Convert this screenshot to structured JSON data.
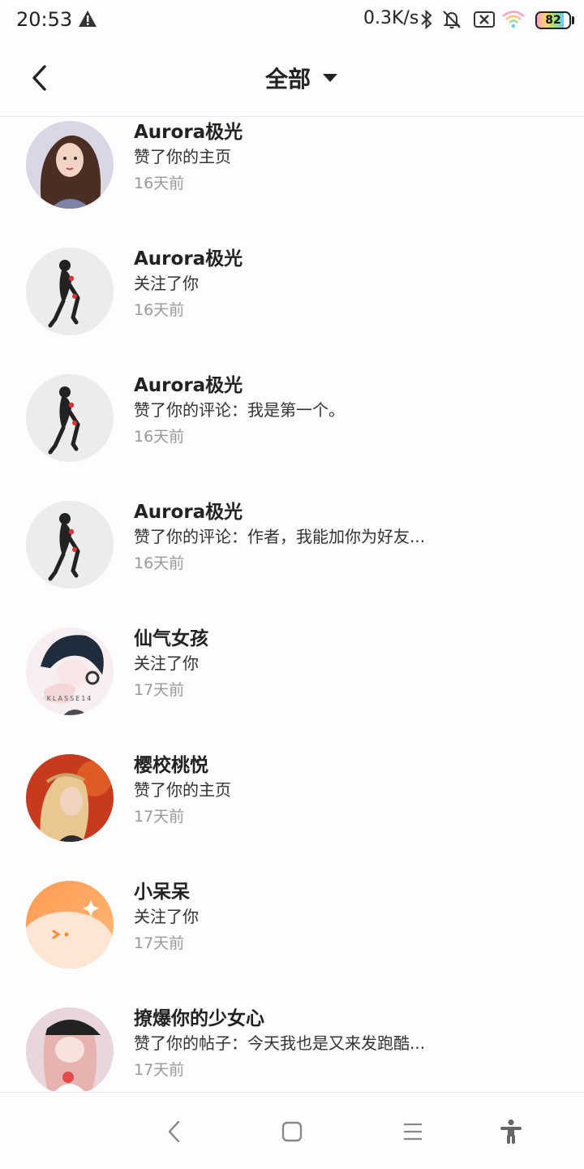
{
  "status_bar": {
    "time": "20:53",
    "net_speed": "0.3K/s",
    "battery": "82",
    "battery_level": 0.82,
    "icons": [
      "warning-icon",
      "bluetooth-icon",
      "bell-muted-icon",
      "sim-off-icon",
      "wifi-icon",
      "battery-icon"
    ]
  },
  "header": {
    "title": "全部",
    "back_icon": "chevron-left-icon",
    "dropdown_icon": "caret-down-icon"
  },
  "notifications": [
    {
      "name": "Aurora极光",
      "action": "赞了你的主页",
      "time": "16天前",
      "avatar": "avatar-curly-girl"
    },
    {
      "name": "Aurora极光",
      "action": "关注了你",
      "time": "16天前",
      "avatar": "avatar-anime-figure"
    },
    {
      "name": "Aurora极光",
      "action": "赞了你的评论：我是第一个。",
      "time": "16天前",
      "avatar": "avatar-anime-figure"
    },
    {
      "name": "Aurora极光",
      "action": "赞了你的评论：作者，我能加你为好友...",
      "time": "16天前",
      "avatar": "avatar-anime-figure"
    },
    {
      "name": "仙气女孩",
      "action": "关注了你",
      "time": "17天前",
      "avatar": "avatar-sketch-girl",
      "avatar_text": "KLASSE14"
    },
    {
      "name": "樱校桃悦",
      "action": "赞了你的主页",
      "time": "17天前",
      "avatar": "avatar-blonde-braid"
    },
    {
      "name": "小呆呆",
      "action": "关注了你",
      "time": "17天前",
      "avatar": "avatar-orange-face"
    },
    {
      "name": "撩爆你的少女心",
      "action": "赞了你的帖子：今天我也是又来发跑酷...",
      "time": "17天前",
      "avatar": "avatar-cap-girl"
    }
  ],
  "nav_bar": {
    "buttons": [
      "back-icon",
      "home-icon",
      "menu-icon",
      "accessibility-icon"
    ]
  },
  "colors": {
    "background": "#fdfcfe",
    "name_text": "#222222",
    "time_text": "#999999",
    "divider": "#e9e9ee"
  }
}
